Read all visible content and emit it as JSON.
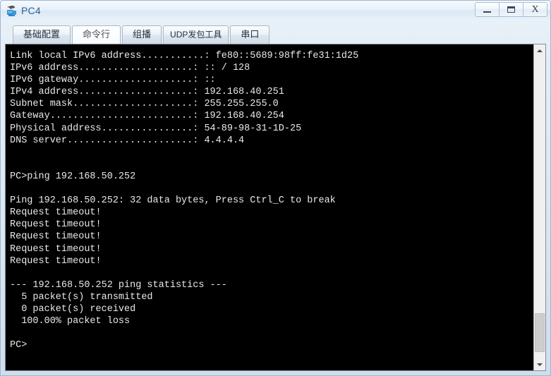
{
  "window": {
    "title": "PC4",
    "icon": "pc-device-icon",
    "controls": {
      "minimize": "minimize-icon",
      "maximize": "maximize-icon",
      "close": "X"
    }
  },
  "tabs": [
    {
      "label": "基础配置",
      "active": false
    },
    {
      "label": "命令行",
      "active": true
    },
    {
      "label": "组播",
      "active": false
    },
    {
      "label": "UDP发包工具",
      "active": false,
      "small": true
    },
    {
      "label": "串口",
      "active": false
    }
  ],
  "terminal": {
    "background": "#000000",
    "foreground": "#e9e9e9",
    "lines": [
      "Link local IPv6 address...........: fe80::5689:98ff:fe31:1d25",
      "IPv6 address....................: :: / 128",
      "IPv6 gateway....................: ::",
      "IPv4 address....................: 192.168.40.251",
      "Subnet mask.....................: 255.255.255.0",
      "Gateway.........................: 192.168.40.254",
      "Physical address................: 54-89-98-31-1D-25",
      "DNS server......................: 4.4.4.4",
      "",
      "",
      "PC>ping 192.168.50.252",
      "",
      "Ping 192.168.50.252: 32 data bytes, Press Ctrl_C to break",
      "Request timeout!",
      "Request timeout!",
      "Request timeout!",
      "Request timeout!",
      "Request timeout!",
      "",
      "--- 192.168.50.252 ping statistics ---",
      "  5 packet(s) transmitted",
      "  0 packet(s) received",
      "  100.00% packet loss",
      "",
      "PC>"
    ]
  },
  "scrollbar": {
    "up_arrow": "chevron-up-icon",
    "down_arrow": "chevron-down-icon",
    "thumb_top_pct": 85,
    "thumb_height_pct": 13
  }
}
